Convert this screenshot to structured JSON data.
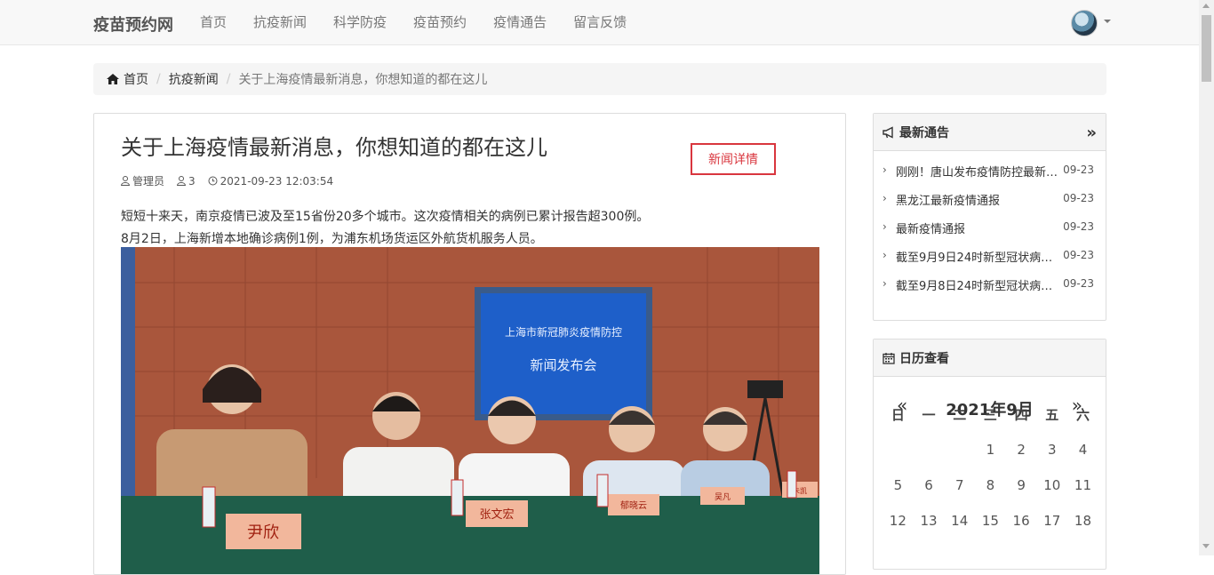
{
  "nav": {
    "brand": "疫苗预约网",
    "items": [
      "首页",
      "抗疫新闻",
      "科学防疫",
      "疫苗预约",
      "疫情通告",
      "留言反馈"
    ]
  },
  "breadcrumb": {
    "home": "首页",
    "section": "抗疫新闻",
    "current": "关于上海疫情最新消息，你想知道的都在这儿"
  },
  "article": {
    "title": "关于上海疫情最新消息，你想知道的都在这儿",
    "badge": "新闻详情",
    "author": "管理员",
    "views": "3",
    "datetime": "2021-09-23 12:03:54",
    "para1": "短短十来天，南京疫情已波及至15省份20多个城市。这次疫情相关的病例已累计报告超300例。",
    "para2": "8月2日，上海新增本地确诊病例1例，为浦东机场货运区外航货机服务人员。",
    "photo": {
      "screen_line1": "上海市新冠肺炎疫情防控",
      "screen_line2": "新闻发布会",
      "nameplates": [
        "尹欣",
        "张文宏",
        "郁晓云",
        "吴凡",
        "朱凯"
      ]
    }
  },
  "notices": {
    "title": "最新通告",
    "items": [
      {
        "text": "刚刚！唐山发布疫情防控最新消息",
        "date": "09-23"
      },
      {
        "text": "黑龙江最新疫情通报",
        "date": "09-23"
      },
      {
        "text": "最新疫情通报",
        "date": "09-23"
      },
      {
        "text": "截至9月9日24时新型冠状病毒肺炎疫情最新情况",
        "date": "09-23"
      },
      {
        "text": "截至9月8日24时新型冠状病毒肺炎疫情最新情况",
        "date": "09-23"
      }
    ]
  },
  "calendar": {
    "title": "日历查看",
    "month": "2021年9月",
    "prev": "«",
    "next": "»",
    "weekdays": [
      "日",
      "一",
      "二",
      "三",
      "四",
      "五",
      "六"
    ],
    "rows": [
      [
        "",
        "",
        "",
        "1",
        "2",
        "3",
        "4"
      ],
      [
        "5",
        "6",
        "7",
        "8",
        "9",
        "10",
        "11"
      ],
      [
        "12",
        "13",
        "14",
        "15",
        "16",
        "17",
        "18"
      ]
    ]
  },
  "colors": {
    "accent_red": "#d9363e",
    "navbar_bg": "#f8f8f8"
  }
}
